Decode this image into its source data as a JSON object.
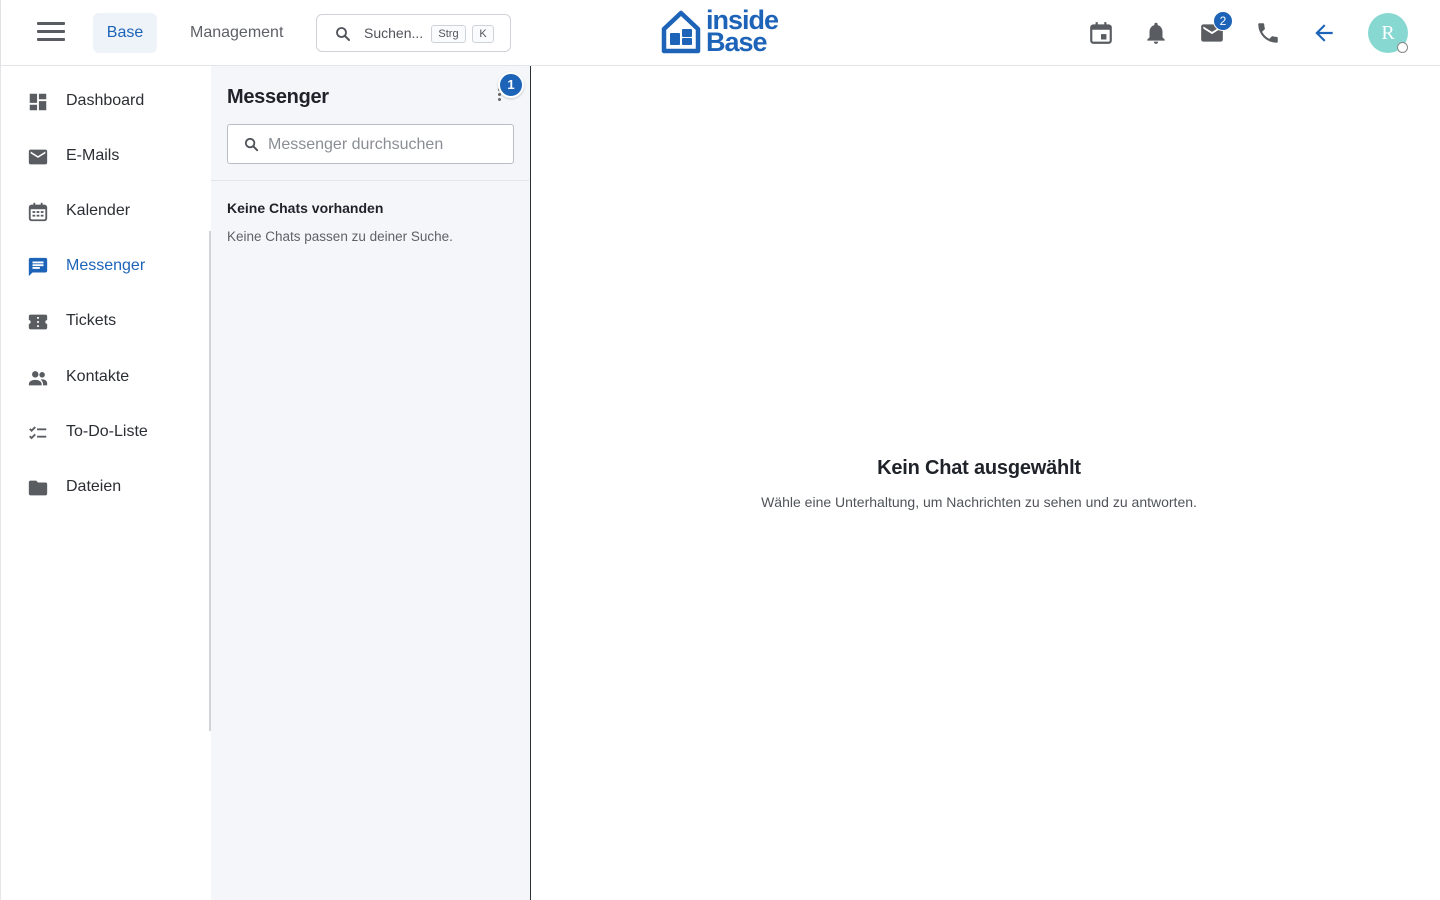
{
  "header": {
    "tabs": [
      {
        "label": "Base",
        "active": true
      },
      {
        "label": "Management",
        "active": false
      }
    ],
    "search": {
      "placeholder": "Suchen...",
      "shortcut_mod": "Strg",
      "shortcut_key": "K"
    },
    "logo": {
      "line1": "inside",
      "line2": "Base"
    },
    "icons": [
      "calendar-icon",
      "bell-icon",
      "mail-icon",
      "phone-icon",
      "arrow-back-icon"
    ],
    "mail_badge": "2",
    "avatar_initial": "R",
    "accent_color": "#1d64b8"
  },
  "sidebar": {
    "items": [
      {
        "label": "Dashboard",
        "icon": "dashboard-icon"
      },
      {
        "label": "E-Mails",
        "icon": "mail-icon"
      },
      {
        "label": "Kalender",
        "icon": "calendar-icon"
      },
      {
        "label": "Messenger",
        "icon": "chat-icon",
        "active": true
      },
      {
        "label": "Tickets",
        "icon": "ticket-icon"
      },
      {
        "label": "Kontakte",
        "icon": "people-icon"
      },
      {
        "label": "To-Do-Liste",
        "icon": "checklist-icon"
      },
      {
        "label": "Dateien",
        "icon": "folder-icon"
      }
    ]
  },
  "messenger": {
    "title": "Messenger",
    "badge": "1",
    "search_placeholder": "Messenger durchsuchen",
    "empty_title": "Keine Chats vorhanden",
    "empty_subtitle": "Keine Chats passen zu deiner Suche."
  },
  "main": {
    "title": "Kein Chat ausgewählt",
    "subtitle": "Wähle eine Unterhaltung, um Nachrichten zu sehen und zu antworten."
  }
}
